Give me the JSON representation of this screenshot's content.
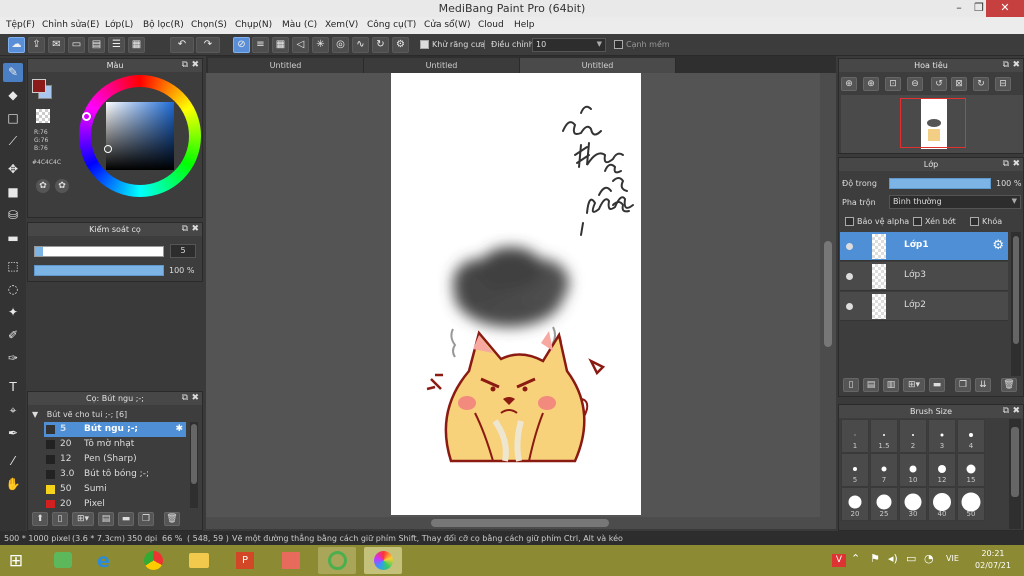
{
  "app": {
    "title": "MediBang Paint Pro (64bit)"
  },
  "menu": [
    "Tệp(F)",
    "Chỉnh sửa(E)",
    "Lớp(L)",
    "Bộ lọc(R)",
    "Chọn(S)",
    "Chụp(N)",
    "Màu (C)",
    "Xem(V)",
    "Công cụ(T)",
    "Cửa sổ(W)",
    "Cloud",
    "Help"
  ],
  "toolbar": {
    "antialias_label": "Khử răng cưa",
    "adjust_label": "Điều chỉnh",
    "adjust_value": "10",
    "soft_edge_label": "Cạnh mềm"
  },
  "tabs": [
    "Untitled",
    "Untitled",
    "Untitled"
  ],
  "color_panel": {
    "title": "Màu",
    "r": "R:76",
    "g": "G:76",
    "b": "B:76",
    "hex": "#4C4C4C",
    "fg": "#8b1a1a",
    "bg": "#a9c7ee"
  },
  "brush_control": {
    "title": "Kiểm soát cọ",
    "size": "5",
    "opacity": "100 %",
    "opacity_fraction": 1.0
  },
  "brush_panel": {
    "title": "Cọ: Bút ngu ;-;",
    "group": "Bút vẽ cho tui ;-; [6]",
    "items": [
      {
        "size": "5",
        "name": "Bút ngu ;-;",
        "color": "#333333",
        "selected": true
      },
      {
        "size": "20",
        "name": "Tô mờ nhạt",
        "color": "#333333"
      },
      {
        "size": "12",
        "name": "Pen (Sharp)",
        "color": "#333333"
      },
      {
        "size": "3.0",
        "name": "Bút tô bóng ;-;",
        "color": "#333333"
      },
      {
        "size": "50",
        "name": "Sumi",
        "color": "#f5d21c"
      },
      {
        "size": "20",
        "name": "Pixel",
        "color": "#d22020"
      }
    ]
  },
  "navigator": {
    "title": "Hoa tiêu"
  },
  "layer_panel": {
    "title": "Lớp",
    "opacity_label": "Độ trong",
    "opacity_value": "100 %",
    "opacity_fraction": 1.0,
    "blend_label": "Pha trộn",
    "blend_value": "Bình thường",
    "protect_alpha": "Bảo vệ alpha",
    "clipping": "Xén bớt",
    "lock": "Khóa",
    "layers": [
      {
        "name": "Lớp1",
        "selected": true
      },
      {
        "name": "Lớp3"
      },
      {
        "name": "Lớp2"
      }
    ]
  },
  "brush_size_panel": {
    "title": "Brush Size",
    "sizes": [
      "1",
      "1.5",
      "2",
      "3",
      "4",
      "5",
      "7",
      "10",
      "12",
      "15",
      "20",
      "25",
      "30",
      "40",
      "50"
    ]
  },
  "status": {
    "dimensions": "500 * 1000 pixel",
    "physical": "(3.6 * 7.3cm)",
    "dpi": "350 dpi",
    "zoom": "66 %",
    "cursor": "( 548, 59 )",
    "hint": "Vẽ một đường thẳng bằng cách giữ phím Shift, Thay đổi cỡ cọ bằng cách giữ phím Ctrl, Alt và kéo"
  },
  "taskbar": {
    "lang": "VIE",
    "time": "20:21",
    "date": "02/07/21"
  }
}
